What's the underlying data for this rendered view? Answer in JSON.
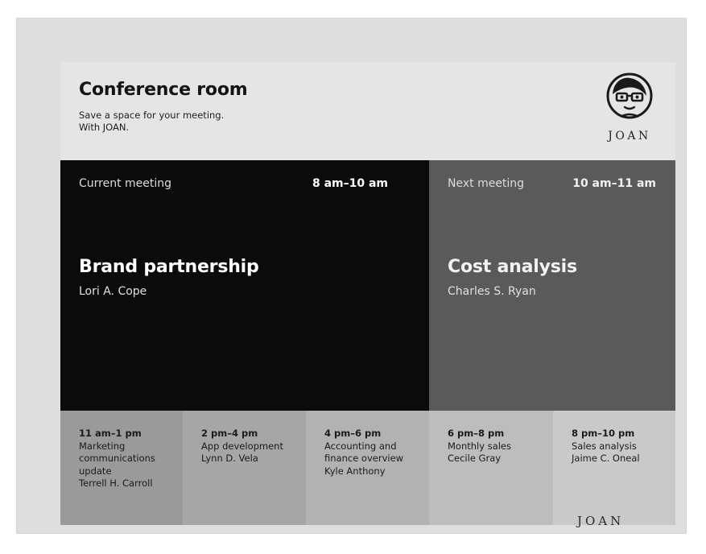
{
  "header": {
    "title": "Conference room",
    "subtitle_line1": "Save a space for your meeting.",
    "subtitle_line2": "With JOAN."
  },
  "logo": {
    "icon": "joan-face-icon",
    "word": "JOAN"
  },
  "current_meeting": {
    "label": "Current meeting",
    "time": "8 am–10 am",
    "title": "Brand partnership",
    "host": "Lori A. Cope"
  },
  "next_meeting": {
    "label": "Next meeting",
    "time": "10 am–11 am",
    "title": "Cost analysis",
    "host": "Charles S. Ryan"
  },
  "schedule": [
    {
      "time": "11 am–1 pm",
      "title": "Marketing communications update",
      "host": "Terrell H. Carroll"
    },
    {
      "time": "2 pm–4 pm",
      "title": "App development",
      "host": "Lynn D. Vela"
    },
    {
      "time": "4 pm–6 pm",
      "title": "Accounting and finance overview",
      "host": "Kyle Anthony"
    },
    {
      "time": "6 pm–8 pm",
      "title": "Monthly sales",
      "host": "Cecile Gray"
    },
    {
      "time": "8 pm–10 pm",
      "title": "Sales analysis",
      "host": "Jaime C. Oneal"
    }
  ],
  "footer": {
    "brand": "JOAN"
  },
  "colors": {
    "current_bg": "#0b0b0b",
    "next_bg": "#5a5a5a",
    "slot_1_bg": "#9a9a9a",
    "slot_2_bg": "#a6a6a6",
    "slot_3_bg": "#b2b2b2",
    "slot_4_bg": "#bdbdbd",
    "slot_5_bg": "#c9c9c9"
  }
}
